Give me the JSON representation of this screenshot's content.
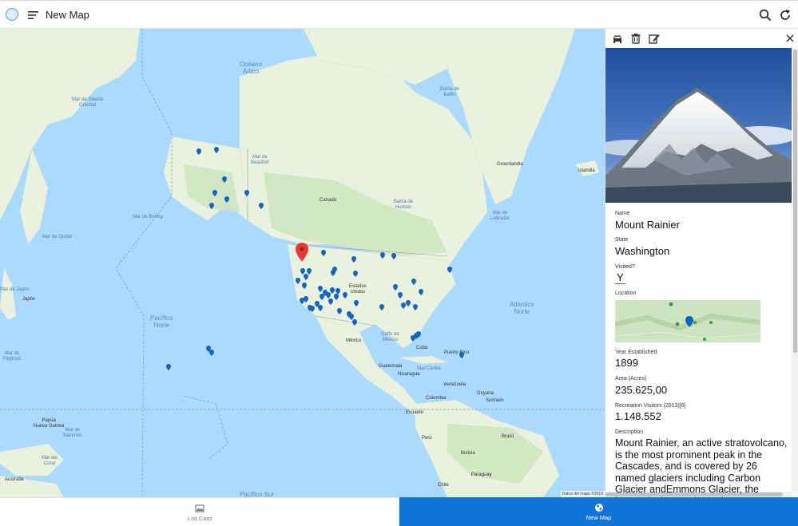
{
  "header": {
    "title": "New Map",
    "logo_icon": "globe-icon",
    "menu_icon": "menu-icon",
    "search_icon": "search-icon",
    "refresh_icon": "refresh-icon"
  },
  "map": {
    "ocean_labels": {
      "arctic": "Océano\nÁrtico",
      "pacific_north": "Pacífico\nNorte",
      "atlantic": "Atlántico\nNorte",
      "pacific_south": "Pacífico Sur"
    },
    "sea_labels": {
      "east_siberian": "Mar de Siberia\nOriental",
      "bering": "Mar de Bering",
      "okhotsk": "Mar de Ojotsk",
      "japan": "Mar de Japón",
      "beaufort": "Mar de\nBeaufort",
      "baffin": "Bahía de\nBaffin",
      "labrador": "Mar de\nLabrador",
      "hudson": "Bahía de\nHudson",
      "caribbean": "Mar Caribe",
      "gulf_mexico": "Golfo de\nMéxico",
      "philippine": "Mar de\nFilipinas",
      "coral": "Mar del\nCoral",
      "solomon": "Mar de\nSalomón"
    },
    "country_labels": {
      "canada": "Canadá",
      "usa": "Estados\nUnidos",
      "mexico": "México",
      "greenland": "Groenlandia",
      "iceland": "Islandia",
      "japan": "Japón",
      "cuba": "Cuba",
      "guatemala": "Guatemala",
      "nicaragua": "Nicaragua",
      "venezuela": "Venezuela",
      "colombia": "Colombia",
      "peru": "Perú",
      "brasil": "Brasil",
      "bolivia": "Bolivia",
      "chile": "Chile",
      "paraguay": "Paraguay",
      "ecuador": "Ecuador",
      "papua": "Papúa\nNueva Guinea",
      "australia": "Australia",
      "puerto_rico": "Puerto Rico",
      "surinam": "Surinam",
      "guyana": "Guyana"
    },
    "attribution": "Datos del mapa ©2019",
    "selected_pin_color": "#e53935",
    "pin_color": "#1565c0"
  },
  "panel": {
    "toolbar": {
      "car_icon": "car-icon",
      "delete_icon": "trash-icon",
      "edit_icon": "edit-icon",
      "close_icon": "close-icon"
    },
    "fields": {
      "name_label": "Name",
      "name_value": "Mount Rainier",
      "state_label": "State",
      "state_value": "Washington",
      "visited_label": "Visited?",
      "visited_value": "Y",
      "location_label": "Location",
      "year_label": "Year Established",
      "year_value": "1899",
      "area_label": "Area (Acres)",
      "area_value": "235.625,00",
      "visitors_label": "Recreation Visitors (2013)[6]",
      "visitors_value": "1.148.552",
      "description_label": "Description",
      "description_value": "Mount Rainier, an active stratovolcano, is the most prominent peak in the Cascades, and is covered by 26 named glaciers including Carbon Glacier andEmmons Glacier, the largest in the continental"
    }
  },
  "tabs": [
    {
      "label": "List Card",
      "icon": "list-card-icon",
      "active": false
    },
    {
      "label": "New Map",
      "icon": "globe-icon",
      "active": true
    }
  ],
  "colors": {
    "accent": "#1175d7",
    "ocean": "#aadaff",
    "land": "#e8f2dc"
  }
}
